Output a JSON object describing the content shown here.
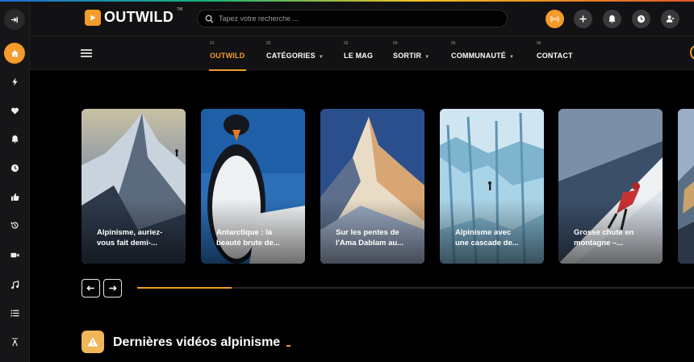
{
  "brand": {
    "name": "OUTWILD",
    "tm": "TM"
  },
  "search": {
    "placeholder": "Tapez votre recherche ..."
  },
  "header_buttons": [
    "live-icon",
    "plus-icon",
    "bell-icon",
    "clock-icon",
    "user-icon"
  ],
  "sidebar": {
    "items": [
      "login-icon",
      "home-icon",
      "bolt-icon",
      "heart-icon",
      "bell-icon",
      "clock-icon",
      "thumbs-up-icon",
      "history-icon",
      "video-icon",
      "music-icon",
      "list-icon",
      "podcast-icon"
    ]
  },
  "nav": {
    "items": [
      {
        "num": "01",
        "label": "OUTWILD",
        "caret": false
      },
      {
        "num": "02",
        "label": "CATÉGORIES",
        "caret": true
      },
      {
        "num": "03",
        "label": "LE MAG",
        "caret": false
      },
      {
        "num": "04",
        "label": "SORTIR",
        "caret": true
      },
      {
        "num": "05",
        "label": "COMMUNAUTÉ",
        "caret": true
      },
      {
        "num": "06",
        "label": "CONTACT",
        "caret": false
      }
    ]
  },
  "cards": [
    {
      "line1": "Alpinisme, auriez-",
      "line2": "vous fait demi-..."
    },
    {
      "line1": "Antarctique : la",
      "line2": "beauté brute de..."
    },
    {
      "line1": "Sur les pentes de",
      "line2": "l'Ama Dablam au..."
    },
    {
      "line1": "Alpinisme avec",
      "line2": "une cascade de..."
    },
    {
      "line1": "Grosse chute en",
      "line2": "montagne –..."
    }
  ],
  "carousel": {
    "progress_fraction": 0.17
  },
  "section": {
    "title": "Dernières vidéos alpinisme"
  },
  "colors": {
    "accent": "#f39b2b",
    "sidebar_bg": "#161618",
    "header_bg": "#121214"
  }
}
